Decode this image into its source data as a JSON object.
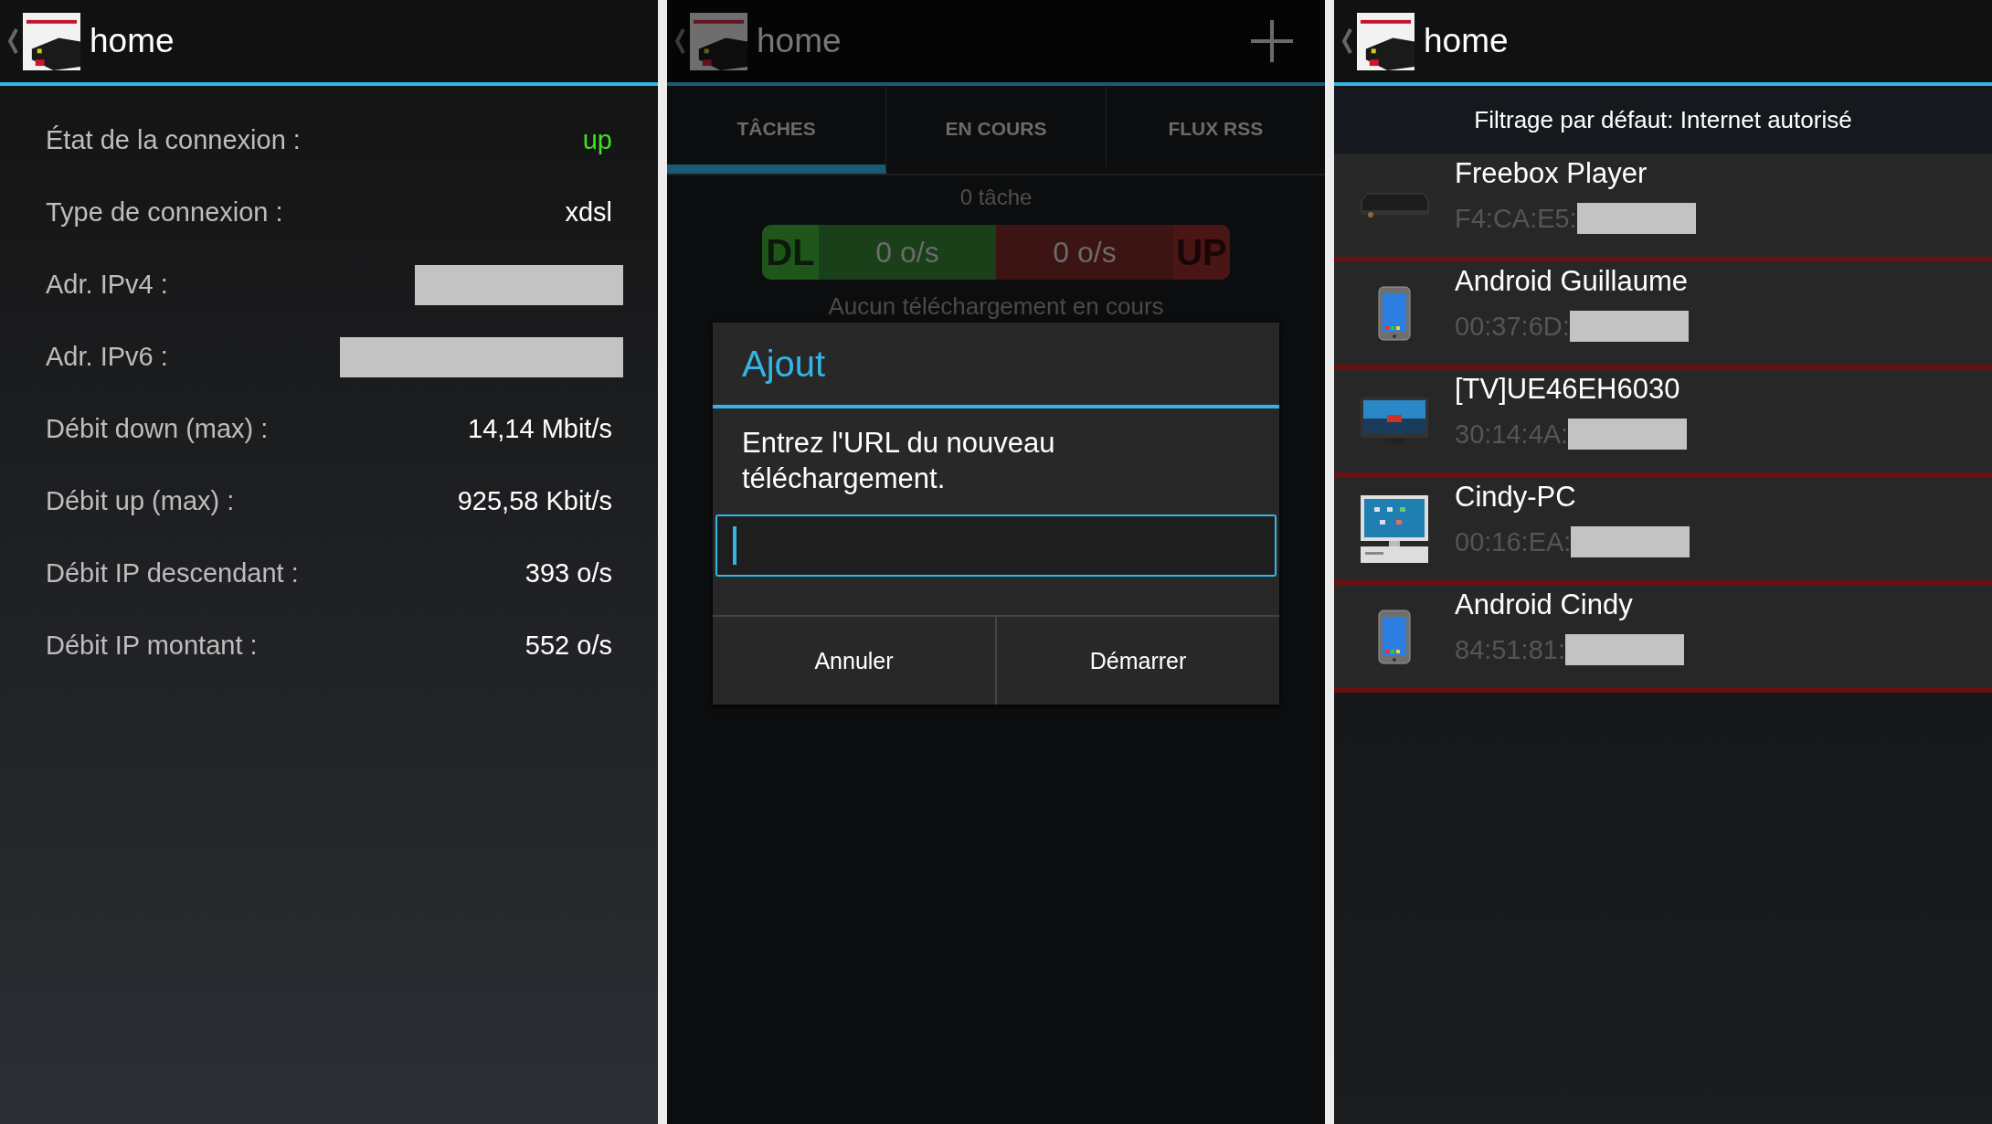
{
  "info_screen": {
    "action_bar": {
      "title": "home"
    },
    "rows": [
      {
        "label": "État de la connexion :",
        "value": "up",
        "kind": "status"
      },
      {
        "label": "Type de connexion :",
        "value": "xdsl",
        "kind": "text"
      },
      {
        "label": "Adr. IPv4 :",
        "kind": "redacted"
      },
      {
        "label": "Adr. IPv6 :",
        "kind": "redacted-wide"
      },
      {
        "label": "Débit down (max) :",
        "value": "14,14 Mbit/s",
        "kind": "text"
      },
      {
        "label": "Débit up (max) :",
        "value": "925,58 Kbit/s",
        "kind": "text"
      },
      {
        "label": "Débit IP descendant :",
        "value": "393 o/s",
        "kind": "text"
      },
      {
        "label": "Débit IP montant :",
        "value": "552 o/s",
        "kind": "text"
      }
    ]
  },
  "downloads_screen": {
    "action_bar": {
      "title": "home"
    },
    "tabs": [
      {
        "label": "TÂCHES",
        "selected": true
      },
      {
        "label": "EN COURS",
        "selected": false
      },
      {
        "label": "FLUX RSS",
        "selected": false
      }
    ],
    "task_count": "0 tâche",
    "speed_bar": {
      "download_label": "DL",
      "download_rate": "0 o/s",
      "upload_rate": "0 o/s",
      "upload_label": "UP"
    },
    "status": "Aucun téléchargement en cours",
    "dialog": {
      "title": "Ajout",
      "message": "Entrez l'URL du nouveau téléchargement.",
      "buttons": [
        "Annuler",
        "Démarrer"
      ]
    }
  },
  "devices_screen": {
    "action_bar": {
      "title": "home"
    },
    "filter": "Filtrage par défaut: Internet autorisé",
    "devices": [
      {
        "name": "Freebox Player",
        "mac": "F4:CA:E5:",
        "kind": "settop"
      },
      {
        "name": "Android Guillaume",
        "mac": "00:37:6D:",
        "kind": "phone"
      },
      {
        "name": "[TV]UE46EH6030",
        "mac": "30:14:4A:",
        "kind": "tv"
      },
      {
        "name": "Cindy-PC",
        "mac": "00:16:EA:",
        "kind": "desktop"
      },
      {
        "name": "Android Cindy",
        "mac": "84:51:81:",
        "kind": "phone"
      }
    ]
  }
}
